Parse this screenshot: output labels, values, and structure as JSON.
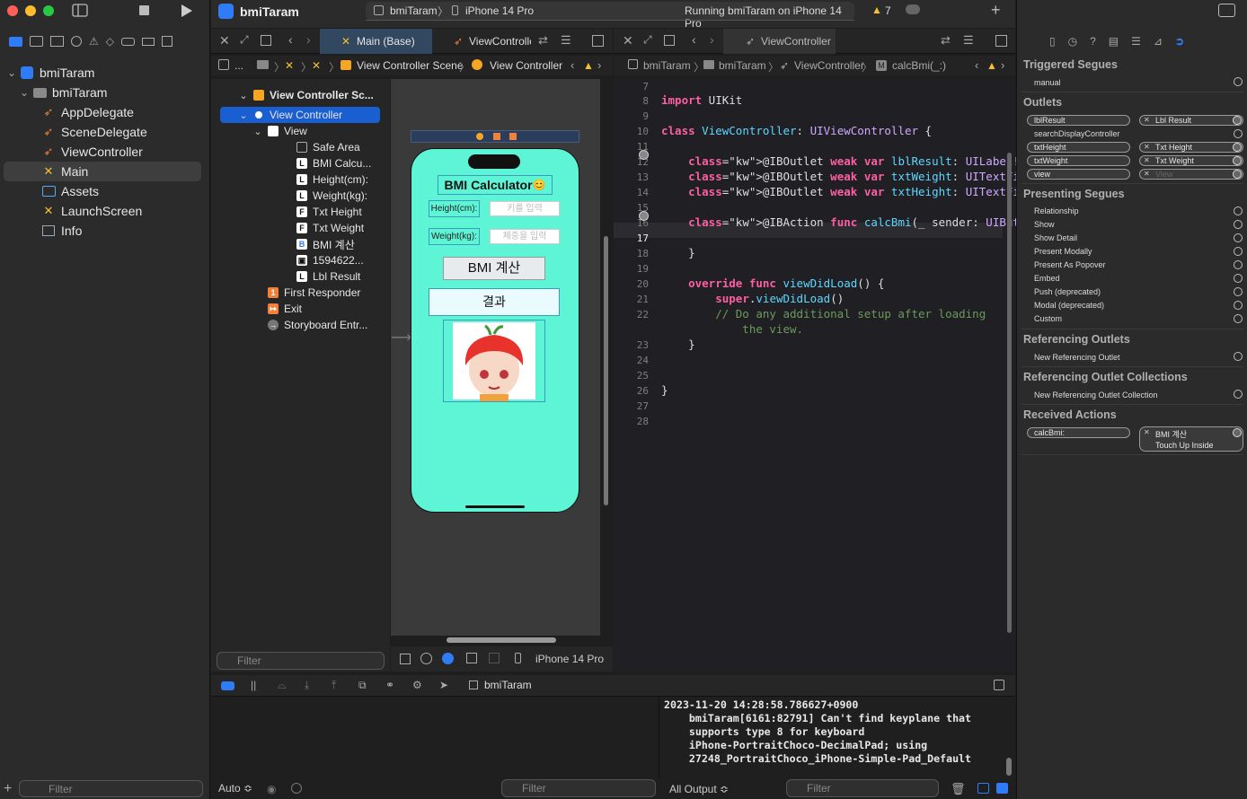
{
  "project": {
    "name": "bmiTaram"
  },
  "status": {
    "scheme": "bmiTaram",
    "device": "iPhone 14 Pro",
    "running": "Running bmiTaram on iPhone 14 Pro",
    "warnings": "7"
  },
  "navigator": {
    "items": [
      {
        "label": "bmiTaram",
        "icon": "project-icon"
      },
      {
        "label": "bmiTaram",
        "icon": "folder-icon"
      },
      {
        "label": "AppDelegate",
        "icon": "swift-icon"
      },
      {
        "label": "SceneDelegate",
        "icon": "swift-icon"
      },
      {
        "label": "ViewController",
        "icon": "swift-icon"
      },
      {
        "label": "Main",
        "icon": "storyboard-icon"
      },
      {
        "label": "Assets",
        "icon": "assets-icon"
      },
      {
        "label": "LaunchScreen",
        "icon": "storyboard-icon"
      },
      {
        "label": "Info",
        "icon": "plist-icon"
      }
    ],
    "filter_placeholder": "Filter"
  },
  "tabs": {
    "left": [
      {
        "label": "Main (Base)"
      },
      {
        "label": "ViewControlle"
      }
    ],
    "right": [
      {
        "label": "ViewController"
      }
    ]
  },
  "jumpbar": {
    "left": [
      "...",
      "View Controller Scene",
      "View Controller"
    ],
    "right": [
      "bmiTaram",
      "bmiTaram",
      "ViewController",
      "calcBmi(_:)"
    ]
  },
  "outline": {
    "items": [
      "View Controller Sc...",
      "View Controller",
      "View",
      "Safe Area",
      "BMI Calcu...",
      "Height(cm):",
      "Weight(kg):",
      "Txt Height",
      "Txt Weight",
      "BMI 계산",
      "1594622...",
      "Lbl Result",
      "First Responder",
      "Exit",
      "Storyboard Entr..."
    ],
    "filter_placeholder": "Filter"
  },
  "phone": {
    "title": "BMI Calculator",
    "emoji": "😊",
    "height_label": "Height(cm):",
    "height_placeholder": "키를 입력",
    "weight_label": "Weight(kg):",
    "weight_placeholder": "체중을 입력",
    "button": "BMI 계산",
    "result": "결과"
  },
  "canvas_bar": {
    "device": "iPhone 14 Pro"
  },
  "code": {
    "lines": [
      {
        "n": "7",
        "t": ""
      },
      {
        "n": "8",
        "t": "import UIKit"
      },
      {
        "n": "9",
        "t": ""
      },
      {
        "n": "10",
        "t": "class ViewController: UIViewController {"
      },
      {
        "n": "11",
        "t": ""
      },
      {
        "n": "12",
        "t": "    @IBOutlet weak var lblResult: UILabel!"
      },
      {
        "n": "13",
        "t": "    @IBOutlet weak var txtWeight: UITextField!"
      },
      {
        "n": "14",
        "t": "    @IBOutlet weak var txtHeight: UITextField!"
      },
      {
        "n": "15",
        "t": ""
      },
      {
        "n": "16",
        "t": "    @IBAction func calcBmi(_ sender: UIButton) {"
      },
      {
        "n": "17",
        "t": ""
      },
      {
        "n": "18",
        "t": "    }"
      },
      {
        "n": "19",
        "t": ""
      },
      {
        "n": "20",
        "t": "    override func viewDidLoad() {"
      },
      {
        "n": "21",
        "t": "        super.viewDidLoad()"
      },
      {
        "n": "22",
        "t": "        // Do any additional setup after loading"
      },
      {
        "n": "",
        "t": "            the view."
      },
      {
        "n": "23",
        "t": "    }"
      },
      {
        "n": "24",
        "t": ""
      },
      {
        "n": "25",
        "t": ""
      },
      {
        "n": "26",
        "t": "}"
      },
      {
        "n": "27",
        "t": ""
      },
      {
        "n": "28",
        "t": ""
      }
    ]
  },
  "inspector": {
    "triggered_segues": "Triggered Segues",
    "manual": "manual",
    "outlets": "Outlets",
    "outlet_rows": [
      {
        "name": "lblResult",
        "target": "Lbl Result"
      },
      {
        "name": "searchDisplayController",
        "target": ""
      },
      {
        "name": "txtHeight",
        "target": "Txt Height"
      },
      {
        "name": "txtWeight",
        "target": "Txt Weight"
      },
      {
        "name": "view",
        "target": "View"
      }
    ],
    "presenting_segues": "Presenting Segues",
    "segues": [
      "Relationship",
      "Show",
      "Show Detail",
      "Present Modally",
      "Present As Popover",
      "Embed",
      "Push (deprecated)",
      "Modal (deprecated)",
      "Custom"
    ],
    "referencing_outlets": "Referencing Outlets",
    "new_ref_outlet": "New Referencing Outlet",
    "referencing_collections": "Referencing Outlet Collections",
    "new_ref_collection": "New Referencing Outlet Collection",
    "received_actions": "Received Actions",
    "action": "calcBmi:",
    "action_target": "BMI 계산",
    "action_event": "Touch Up Inside"
  },
  "debug": {
    "target": "bmiTaram",
    "auto": "Auto ≎",
    "output_selector": "All Output ≎",
    "filter": "Filter",
    "console": [
      "2023-11-20 14:28:58.786627+0900",
      "    bmiTaram[6161:82791] Can't find keyplane that",
      "    supports type 8 for keyboard",
      "    iPhone-PortraitChoco-DecimalPad; using",
      "    27248_PortraitChoco_iPhone-Simple-Pad_Default"
    ]
  },
  "colors": {
    "phone_bg": "#5ef5d6",
    "selection": "#1a5fd1",
    "accent": "#2f7cf6"
  }
}
